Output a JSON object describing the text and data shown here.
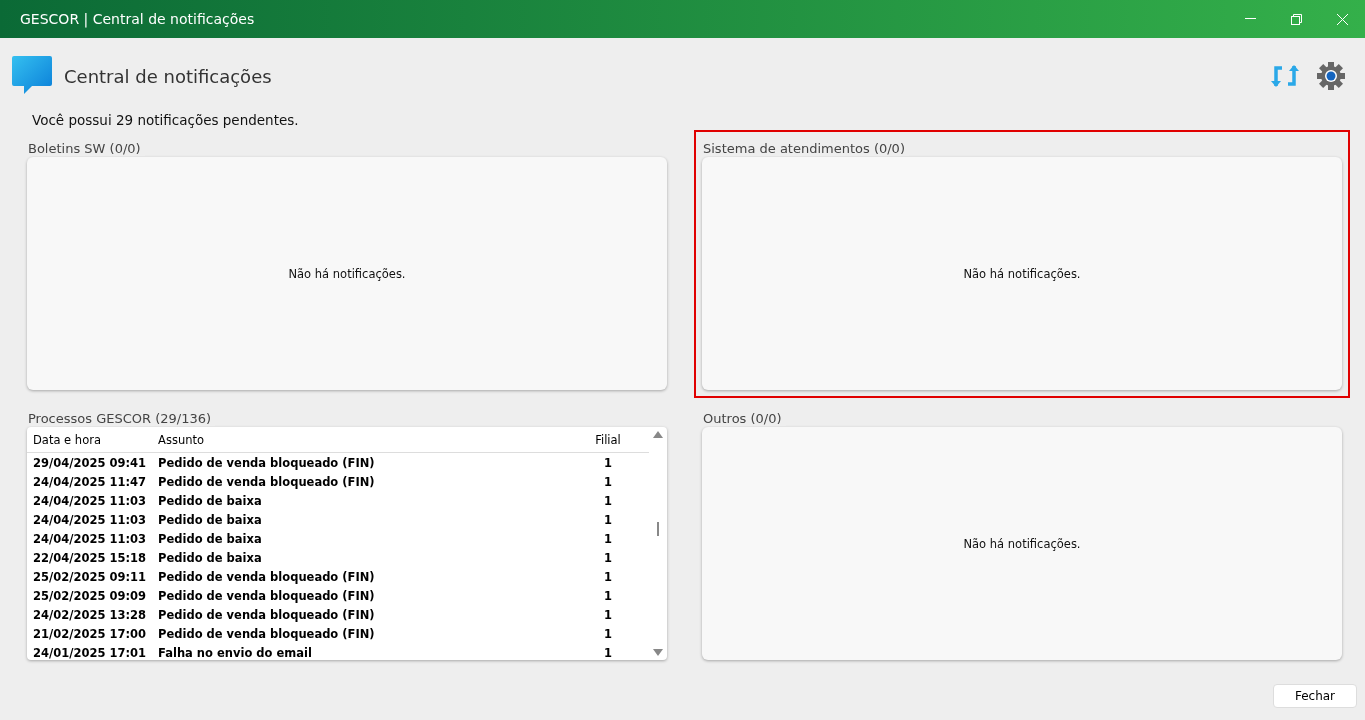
{
  "window": {
    "title": "GESCOR | Central de notificações"
  },
  "header": {
    "title": "Central de notificações"
  },
  "summary": "Você possui 29 notificações pendentes.",
  "panels": [
    {
      "kind": "empty",
      "title": "Boletins SW (0/0)",
      "message": "Não há notificações.",
      "highlighted": false
    },
    {
      "kind": "empty",
      "title": "Sistema de atendimentos (0/0)",
      "message": "Não há notificações.",
      "highlighted": true
    },
    {
      "kind": "table",
      "title": "Processos GESCOR (29/136)",
      "highlighted": false,
      "table": {
        "columns": [
          "Data e hora",
          "Assunto",
          "Filial"
        ],
        "rows": [
          [
            "29/04/2025 09:41",
            "Pedido de venda bloqueado (FIN)",
            "1"
          ],
          [
            "24/04/2025 11:47",
            "Pedido de venda bloqueado (FIN)",
            "1"
          ],
          [
            "24/04/2025 11:03",
            "Pedido de baixa",
            "1"
          ],
          [
            "24/04/2025 11:03",
            "Pedido de baixa",
            "1"
          ],
          [
            "24/04/2025 11:03",
            "Pedido de baixa",
            "1"
          ],
          [
            "22/04/2025 15:18",
            "Pedido de baixa",
            "1"
          ],
          [
            "25/02/2025 09:11",
            "Pedido de venda bloqueado (FIN)",
            "1"
          ],
          [
            "25/02/2025 09:09",
            "Pedido de venda bloqueado (FIN)",
            "1"
          ],
          [
            "24/02/2025 13:28",
            "Pedido de venda bloqueado (FIN)",
            "1"
          ],
          [
            "21/02/2025 17:00",
            "Pedido de venda bloqueado (FIN)",
            "1"
          ],
          [
            "24/01/2025 17:01",
            "Falha no envio do email",
            "1"
          ]
        ]
      }
    },
    {
      "kind": "empty",
      "title": "Outros (0/0)",
      "message": "Não há notificações.",
      "highlighted": false
    }
  ],
  "buttons": [
    "Fechar"
  ]
}
